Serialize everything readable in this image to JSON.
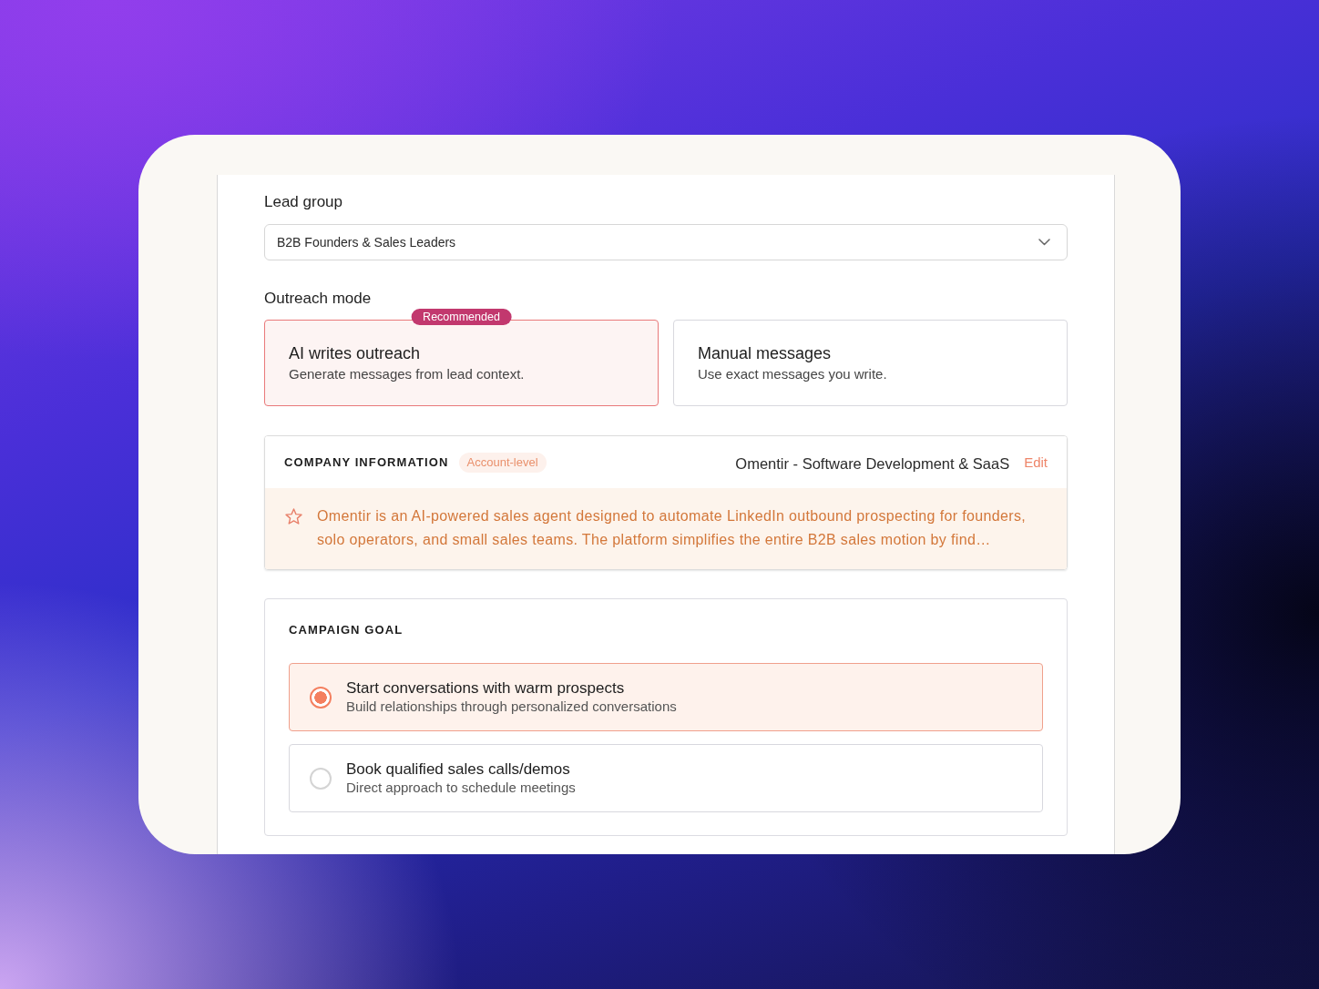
{
  "lead_group": {
    "label": "Lead group",
    "value": "B2B Founders & Sales Leaders"
  },
  "outreach_mode": {
    "label": "Outreach mode",
    "options": [
      {
        "title": "AI writes outreach",
        "description": "Generate messages from lead context.",
        "badge": "Recommended",
        "selected": true
      },
      {
        "title": "Manual messages",
        "description": "Use exact messages you write.",
        "selected": false
      }
    ]
  },
  "company_information": {
    "heading": "COMPANY INFORMATION",
    "badge": "Account-level",
    "company": "Omentir - Software Development & SaaS",
    "edit_link": "Edit",
    "summary": "Omentir is an AI-powered sales agent designed to automate LinkedIn outbound prospecting for founders, solo operators, and small sales teams. The platform simplifies the entire B2B sales motion by find…"
  },
  "campaign_goal": {
    "heading": "CAMPAIGN GOAL",
    "options": [
      {
        "title": "Start conversations with warm prospects",
        "description": "Build relationships through personalized conversations",
        "selected": true
      },
      {
        "title": "Book qualified sales calls/demos",
        "description": "Direct approach to schedule meetings",
        "selected": false
      }
    ]
  }
}
